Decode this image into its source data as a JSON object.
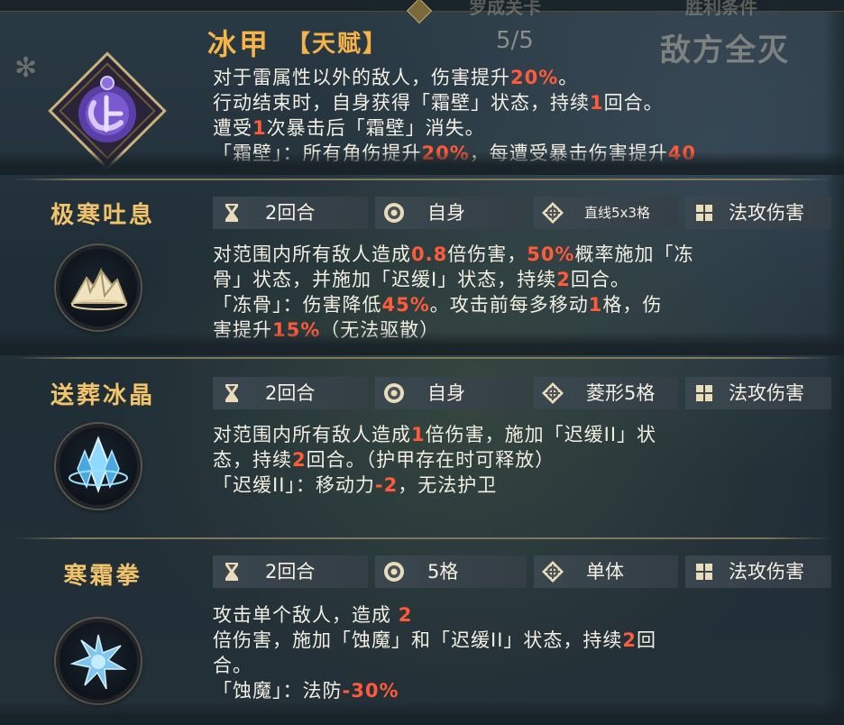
{
  "top": {
    "ghost_left": "罗成关卡",
    "ghost_right": "胜利条件",
    "counter": "5/5",
    "objective": "敌方全灭"
  },
  "talent": {
    "name": "冰甲",
    "tag": "【天赋】",
    "line1_a": "对于雷属性以外的敌人，伤害提升",
    "line1_hl": "20%",
    "line1_b": "。",
    "line2_a": "行动结束时，自身获得「霜壁」状态，持续",
    "line2_hl": "1",
    "line2_b": "回合。",
    "line3_a": "遭受",
    "line3_hl": "1",
    "line3_b": "次暴击后「霜壁」消失。",
    "line4_a": "「霜壁」：所有角伤提升",
    "line4_hl": "20%",
    "line4_b": "，每遭受暴击伤害提升",
    "line4_hl2": "40"
  },
  "skills": [
    {
      "name": "极寒吐息",
      "icon": "ice-mountain-icon",
      "cooldown": "2回合",
      "target": "自身",
      "range": "直线5x3格",
      "type": "法攻伤害",
      "line1_a": "对范围内所有敌人造成",
      "line1_hl": "0.8",
      "line1_b": "倍伤害，",
      "line1_hl2": "50%",
      "line1_c": "概率施加「冻",
      "line2_a": "骨」状态，并施加「迟缓I」状态，持续",
      "line2_hl": "2",
      "line2_b": "回合。",
      "line3_a": "「冻骨」：伤害降低",
      "line3_hl": "45%",
      "line3_b": "。攻击前每多移动",
      "line3_hl2": "1",
      "line3_c": "格，伤",
      "line4_a": "害提升",
      "line4_hl": "15%",
      "line4_b": "（无法驱散）"
    },
    {
      "name": "送葬冰晶",
      "icon": "ice-crystal-icon",
      "cooldown": "2回合",
      "target": "自身",
      "range": "菱形5格",
      "type": "法攻伤害",
      "line1_a": "对范围内所有敌人造成",
      "line1_hl": "1",
      "line1_b": "倍伤害，施加「迟缓II」状",
      "line2_a": "态，持续",
      "line2_hl": "2",
      "line2_b": "回合。（护甲存在时可释放）",
      "line3_a": "「迟缓II」：移动力",
      "line3_hl": "-2",
      "line3_b": "，无法护卫"
    },
    {
      "name": "寒霜拳",
      "icon": "frost-fist-icon",
      "cooldown": "2回合",
      "target": "5格",
      "range": "单体",
      "type": "法攻伤害",
      "line1_a": "攻击单个敌人，造成 ",
      "line1_hl": "2",
      "line2_a": "倍伤害，施加「蚀魔」和「迟缓II」状态，持续",
      "line2_hl": "2",
      "line2_b": "回",
      "line3_a": "合。",
      "line4_a": "「蚀魔」：法防",
      "line4_hl": "-30%"
    }
  ],
  "colors": {
    "gold": "#f6b448",
    "highlight": "#ff5a3a",
    "title": "#f1c36a"
  }
}
